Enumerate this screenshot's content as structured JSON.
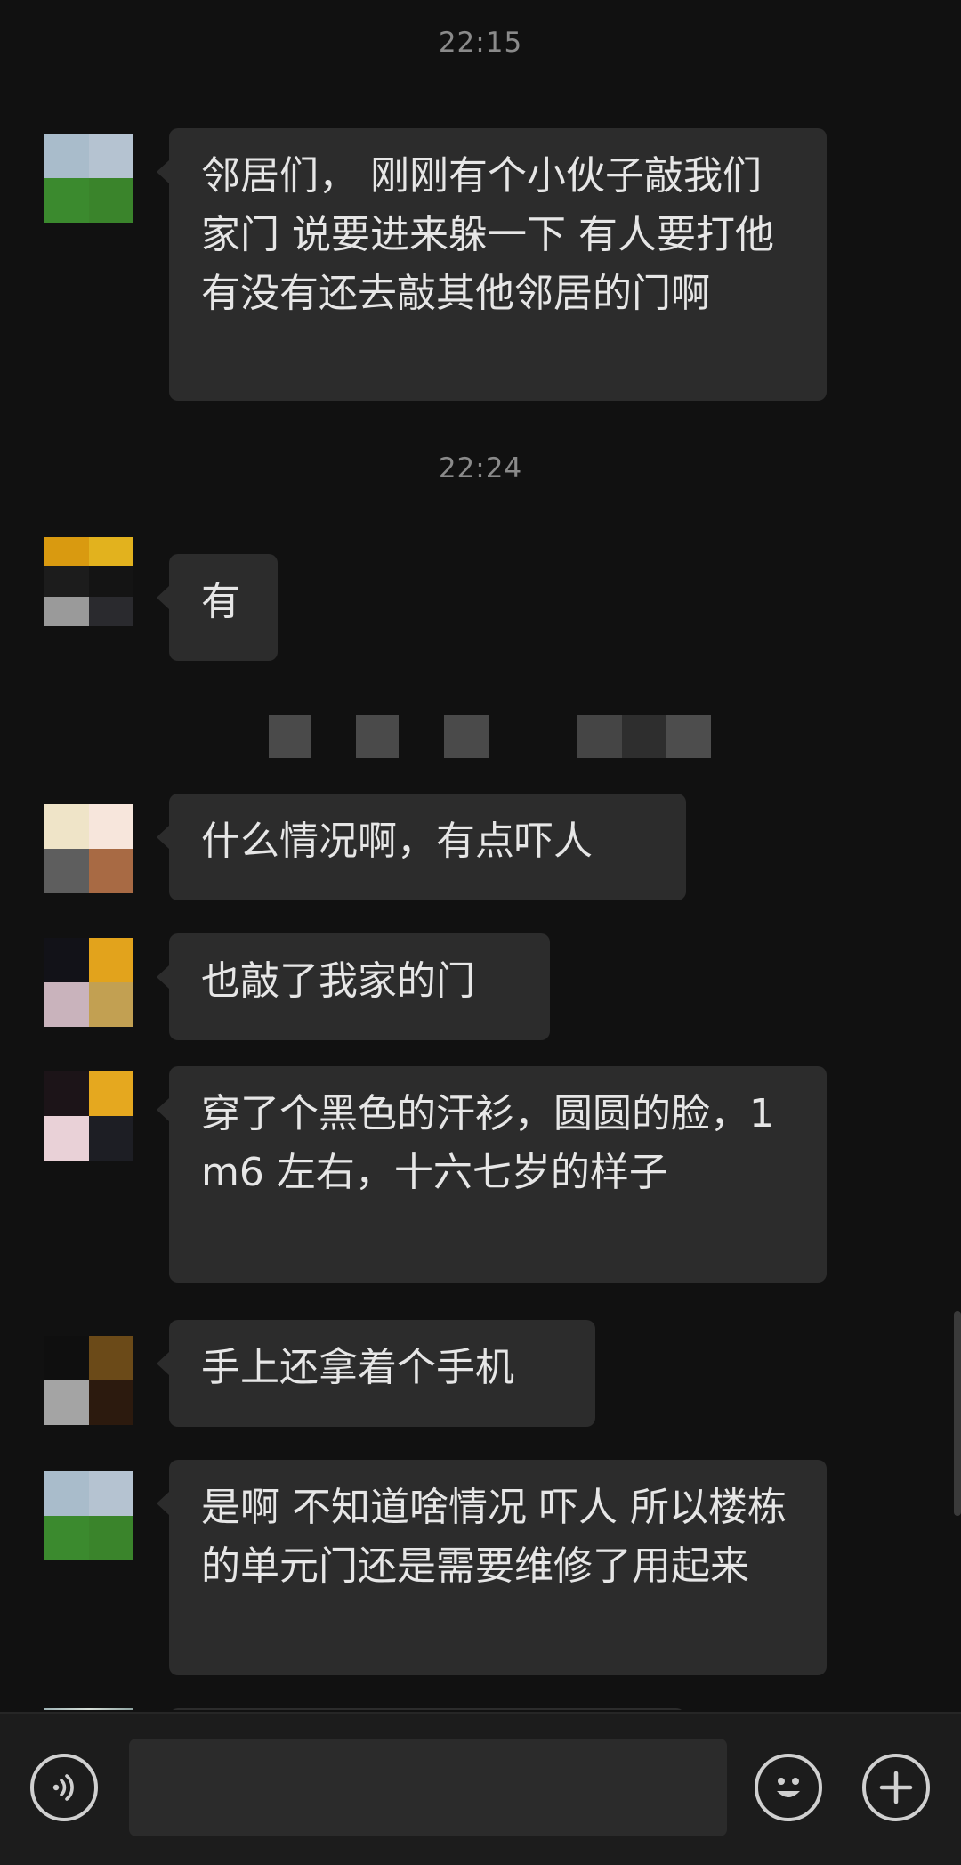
{
  "timestamps": [
    "22:15",
    "22:24"
  ],
  "messages": [
    {
      "text": "邻居们，  刚刚有个小伙子敲我们家门 说要进来躲一下 有人要打他 有没有还去敲其他邻居的门啊",
      "avatar": [
        "#a9bccb",
        "#b5c3d1",
        "#3b8a2e",
        "#3a842b"
      ]
    },
    {
      "text": "有",
      "avatar": [
        "#d99a10",
        "#e2b21e",
        "#1a1a1a",
        "#141414",
        "#9a9a9a",
        "#2a2a2e"
      ]
    },
    {
      "text": "什么情况啊，有点吓人",
      "avatar": [
        "#efe4c8",
        "#f7e6dc",
        "#5e5e5e",
        "#a86a44"
      ]
    },
    {
      "text": "也敲了我家的门",
      "avatar": [
        "#121218",
        "#e2a31c",
        "#c9b3bc",
        "#c2a052"
      ]
    },
    {
      "text": "穿了个黑色的汗衫，圆圆的脸，1m6 左右，十六七岁的样子",
      "avatar": [
        "#1c1418",
        "#e5a81f",
        "#e9d1d7",
        "#1d1e24"
      ]
    },
    {
      "text": "手上还拿着个手机",
      "avatar": [
        "#0f0f0f",
        "#6b4a18",
        "#a4a4a4",
        "#2c1a0e"
      ]
    },
    {
      "text": "是啊 不知道啥情况 吓人 所以楼栋的单元门还是需要维修了用起来",
      "avatar": [
        "#a9bccb",
        "#b5c3d1",
        "#3b8a2e",
        "#3a842b"
      ]
    }
  ],
  "input": {
    "value": "",
    "placeholder": ""
  },
  "icons": {
    "voice": "voice-icon",
    "emoji": "emoji-icon",
    "plus": "plus-icon"
  }
}
